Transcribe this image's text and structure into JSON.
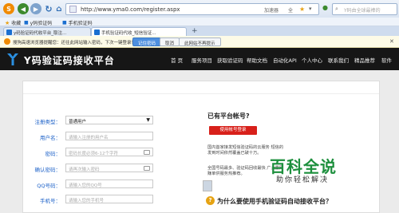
{
  "toolbar": {
    "url": "http://www.yma0.com/register.aspx",
    "url_extras": [
      "加速器",
      "全"
    ],
    "search_placeholder": "Y码由全球最棒的"
  },
  "bookmarks": [
    {
      "label": "收藏"
    },
    {
      "label": "y码验证码"
    },
    {
      "label": "手机验证码"
    }
  ],
  "tabs": [
    {
      "label": "y码验证码代收平台_取注...",
      "active": false
    },
    {
      "label": "手机验证码代收_短信验证...",
      "active": true
    }
  ],
  "notify": {
    "text": "搜狗高速浏览器提醒您：还往此网站输入密码，下次一键登录！",
    "buttons": [
      "记住密码",
      "取消",
      "此网站不再提示"
    ]
  },
  "site": {
    "logo": "Y码验证码接收平台",
    "nav": [
      "首 页",
      "服务项目",
      "获取验证码",
      "帮助文档",
      "自动化API",
      "个人中心",
      "联系我们",
      "精品推荐",
      "软件"
    ]
  },
  "form": {
    "fields": [
      {
        "label": "注册类型：",
        "placeholder": "普通用户",
        "type": "select"
      },
      {
        "label": "用户名：",
        "placeholder": "请输入注册的用户名",
        "type": "text"
      },
      {
        "label": "密码：",
        "placeholder": "密码长度必须6-12个字符",
        "type": "password"
      },
      {
        "label": "确认密码：",
        "placeholder": "请再次输入密码",
        "type": "password"
      },
      {
        "label": "QQ号码：",
        "placeholder": "请输入您的QQ号",
        "type": "text"
      },
      {
        "label": "手机号：",
        "placeholder": "请输入您的手机号",
        "type": "text"
      }
    ]
  },
  "side": {
    "have_account": "已有平台帐号?",
    "login_button": "使用帐号登录",
    "para1": "国内首家接发短信验证码的云服务 短信的发到时间依然覆盖已破十万。",
    "para2": "全国号码最多、验证码回收最快 广大量网赚单供服务热推荐。",
    "why": "为什么要使用手机验证码自动接收平台？"
  },
  "watermark": {
    "title": "百科全说",
    "subtitle": "助你轻松解决"
  },
  "colors": {
    "header_bg": "#161616",
    "label_blue": "#1f63c9",
    "login_red": "#d8201a",
    "watermark_green": "#1d8f3d"
  }
}
